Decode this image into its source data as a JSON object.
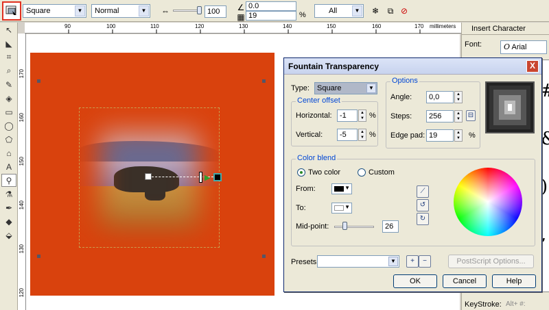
{
  "propbar": {
    "type_value": "Square",
    "mode_value": "Normal",
    "midpoint_value": "100",
    "angle_value": "0.0",
    "steps_value": "19",
    "percent_label": "%",
    "apply_to_value": "All"
  },
  "ruler": {
    "units": "millimeters",
    "h_ticks": [
      "90",
      "100",
      "110",
      "120",
      "130",
      "140",
      "150",
      "160",
      "170"
    ],
    "v_ticks": [
      "170",
      "160",
      "150",
      "140",
      "130",
      "120"
    ]
  },
  "docker": {
    "title": "Insert Character",
    "font_label": "Font:",
    "font_value": "Arial",
    "keystroke_label": "KeyStroke:",
    "keystroke_value": "Alt+ #:"
  },
  "dialog": {
    "title": "Fountain Transparency",
    "close": "X",
    "type_label": "Type:",
    "type_value": "Square",
    "center_offset_title": "Center offset",
    "horizontal_label": "Horizontal:",
    "horizontal_value": "-1",
    "vertical_label": "Vertical:",
    "vertical_value": "-5",
    "percent": "%",
    "options_title": "Options",
    "angle_label": "Angle:",
    "angle_value": "0,0",
    "steps_label": "Steps:",
    "steps_value": "256",
    "edge_pad_label": "Edge pad:",
    "edge_pad_value": "19",
    "color_blend_title": "Color blend",
    "two_color_label": "Two color",
    "custom_label": "Custom",
    "from_label": "From:",
    "to_label": "To:",
    "midpoint_label": "Mid-point:",
    "midpoint_value": "26",
    "midpoint_level": 0.26,
    "presets_label": "Presets:",
    "postscript_label": "PostScript Options...",
    "ok_label": "OK",
    "cancel_label": "Cancel",
    "help_label": "Help"
  },
  "colors": {
    "orange_fill": "#d9420d",
    "dialog_bg": "#ece9d8",
    "group_title": "#0046d5",
    "highlight_frame": "#e03020"
  }
}
